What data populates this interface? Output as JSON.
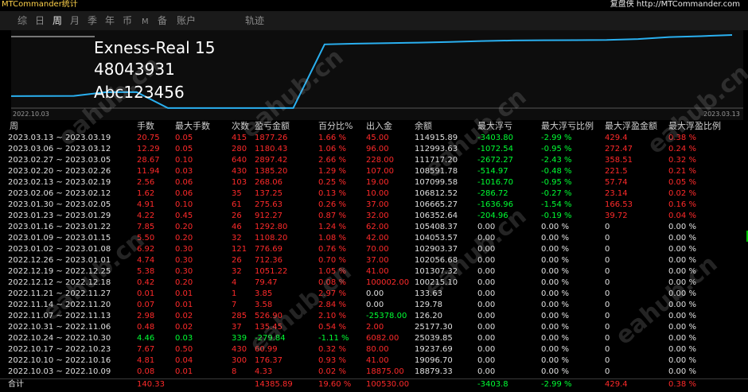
{
  "app_title": "MTCommander统计",
  "credit": "复盘侠 http://MTCommander.com",
  "tabs": [
    "综",
    "日",
    "周",
    "月",
    "季",
    "年",
    "币",
    "M",
    "备",
    "账户",
    "轨迹"
  ],
  "active_tab": "周",
  "account": {
    "name": "Exness-Real 15",
    "number": "48043931",
    "password": "Abc123456"
  },
  "chart_data": {
    "type": "line",
    "x": [
      "2022.10.03",
      "2022.10.10",
      "2022.10.17",
      "2022.10.24",
      "2022.10.31",
      "2022.11.07",
      "2022.11.14",
      "2022.11.21",
      "2022.11.28",
      "2022.12.05",
      "2022.12.12",
      "2022.12.19",
      "2022.12.26",
      "2023.01.02",
      "2023.01.09",
      "2023.01.16",
      "2023.01.23",
      "2023.01.30",
      "2023.02.06",
      "2023.02.13",
      "2023.02.20",
      "2023.02.27",
      "2023.03.06",
      "2023.03.13"
    ],
    "values": [
      18879.33,
      19096.7,
      19237.69,
      25039.85,
      25177.3,
      126.2,
      129.78,
      133.63,
      133.63,
      133.63,
      100215.1,
      101307.32,
      102056.68,
      102903.37,
      104053.57,
      105408.37,
      106352.64,
      106665.27,
      106812.52,
      107099.58,
      108591.78,
      111717.2,
      112993.63,
      114915.89
    ],
    "start_label": "2022.10.03",
    "end_label": "2023.03.13",
    "line_color": "#2ab0f0"
  },
  "table": {
    "headers": [
      "周",
      "手数",
      "最大手数",
      "次数",
      "盈亏金额",
      "百分比%",
      "出入金",
      "余额",
      "最大浮亏",
      "最大浮亏比例",
      "最大浮盈金额",
      "最大浮盈比例"
    ],
    "rows": [
      [
        "2023.03.13 ~ 2023.03.19",
        "20.75",
        "0.05",
        "415",
        "1877.26",
        "1.66 %",
        "45.00",
        "114915.89",
        "-3403.80",
        "-2.99 %",
        "429.4",
        "0.38 %"
      ],
      [
        "2023.03.06 ~ 2023.03.12",
        "12.29",
        "0.05",
        "280",
        "1180.43",
        "1.06 %",
        "96.00",
        "112993.63",
        "-1072.54",
        "-0.95 %",
        "272.47",
        "0.24 %"
      ],
      [
        "2023.02.27 ~ 2023.03.05",
        "28.67",
        "0.10",
        "640",
        "2897.42",
        "2.66 %",
        "228.00",
        "111717.20",
        "-2672.27",
        "-2.43 %",
        "358.51",
        "0.32 %"
      ],
      [
        "2023.02.20 ~ 2023.02.26",
        "11.94",
        "0.03",
        "430",
        "1385.20",
        "1.29 %",
        "107.00",
        "108591.78",
        "-514.97",
        "-0.48 %",
        "221.5",
        "0.21 %"
      ],
      [
        "2023.02.13 ~ 2023.02.19",
        "2.56",
        "0.06",
        "103",
        "268.06",
        "0.25 %",
        "19.00",
        "107099.58",
        "-1016.70",
        "-0.95 %",
        "57.74",
        "0.05 %"
      ],
      [
        "2023.02.06 ~ 2023.02.12",
        "1.62",
        "0.06",
        "35",
        "137.25",
        "0.13 %",
        "10.00",
        "106812.52",
        "-286.72",
        "-0.27 %",
        "23.14",
        "0.02 %"
      ],
      [
        "2023.01.30 ~ 2023.02.05",
        "4.91",
        "0.10",
        "61",
        "275.63",
        "0.26 %",
        "37.00",
        "106665.27",
        "-1636.96",
        "-1.54 %",
        "166.53",
        "0.16 %"
      ],
      [
        "2023.01.23 ~ 2023.01.29",
        "4.22",
        "0.45",
        "26",
        "912.27",
        "0.87 %",
        "32.00",
        "106352.64",
        "-204.96",
        "-0.19 %",
        "39.72",
        "0.04 %"
      ],
      [
        "2023.01.16 ~ 2023.01.22",
        "7.85",
        "0.20",
        "46",
        "1292.80",
        "1.24 %",
        "62.00",
        "105408.37",
        "0.00",
        "0.00 %",
        "0",
        "0.00 %"
      ],
      [
        "2023.01.09 ~ 2023.01.15",
        "5.50",
        "0.20",
        "32",
        "1108.20",
        "1.08 %",
        "42.00",
        "104053.57",
        "0.00",
        "0.00 %",
        "0",
        "0.00 %"
      ],
      [
        "2023.01.02 ~ 2023.01.08",
        "6.92",
        "0.30",
        "121",
        "776.69",
        "0.76 %",
        "70.00",
        "102903.37",
        "0.00",
        "0.00 %",
        "0",
        "0.00 %"
      ],
      [
        "2022.12.26 ~ 2023.01.01",
        "4.74",
        "0.30",
        "26",
        "712.36",
        "0.70 %",
        "37.00",
        "102056.68",
        "0.00",
        "0.00 %",
        "0",
        "0.00 %"
      ],
      [
        "2022.12.19 ~ 2022.12.25",
        "5.38",
        "0.30",
        "32",
        "1051.22",
        "1.05 %",
        "41.00",
        "101307.32",
        "0.00",
        "0.00 %",
        "0",
        "0.00 %"
      ],
      [
        "2022.12.12 ~ 2022.12.18",
        "0.42",
        "0.20",
        "4",
        "79.47",
        "0.08 %",
        "100002.00",
        "100215.10",
        "0.00",
        "0.00 %",
        "0",
        "0.00 %"
      ],
      [
        "2022.11.21 ~ 2022.11.27",
        "0.01",
        "0.01",
        "1",
        "3.85",
        "2.97 %",
        "0.00",
        "133.63",
        "0.00",
        "0.00 %",
        "0",
        "0.00 %"
      ],
      [
        "2022.11.14 ~ 2022.11.20",
        "0.07",
        "0.01",
        "7",
        "3.58",
        "2.84 %",
        "0.00",
        "129.78",
        "0.00",
        "0.00 %",
        "0",
        "0.00 %"
      ],
      [
        "2022.11.07 ~ 2022.11.13",
        "2.98",
        "0.02",
        "285",
        "526.90",
        "2.10 %",
        "-25378.00",
        "126.20",
        "0.00",
        "0.00 %",
        "0",
        "0.00 %"
      ],
      [
        "2022.10.31 ~ 2022.11.06",
        "0.48",
        "0.02",
        "37",
        "135.45",
        "0.54 %",
        "2.00",
        "25177.30",
        "0.00",
        "0.00 %",
        "0",
        "0.00 %"
      ],
      [
        "2022.10.24 ~ 2022.10.30",
        "4.46",
        "0.03",
        "339",
        "-279.84",
        "-1.11 %",
        "6082.00",
        "25039.85",
        "0.00",
        "0.00 %",
        "0",
        "0.00 %"
      ],
      [
        "2022.10.17 ~ 2022.10.23",
        "7.67",
        "0.50",
        "430",
        "60.99",
        "0.32 %",
        "80.00",
        "19237.69",
        "0.00",
        "0.00 %",
        "0",
        "0.00 %"
      ],
      [
        "2022.10.10 ~ 2022.10.16",
        "4.81",
        "0.04",
        "300",
        "176.37",
        "0.93 %",
        "41.00",
        "19096.70",
        "0.00",
        "0.00 %",
        "0",
        "0.00 %"
      ],
      [
        "2022.10.03 ~ 2022.10.09",
        "0.08",
        "0.01",
        "8",
        "4.33",
        "0.02 %",
        "18875.00",
        "18879.33",
        "0.00",
        "0.00 %",
        "0",
        "0.00 %"
      ]
    ],
    "totals": [
      "合计",
      "140.33",
      "",
      "",
      "14385.89",
      "19.60 %",
      "100530.00",
      "",
      "-3403.8",
      "-2.99 %",
      "429.4",
      "0.38 %"
    ]
  },
  "watermark": "eahub.cn",
  "colors": {
    "positive": "#ff2a2a",
    "negative": "#00ff33",
    "neutral": "#e0e0e0",
    "title": "#ffd24a"
  }
}
